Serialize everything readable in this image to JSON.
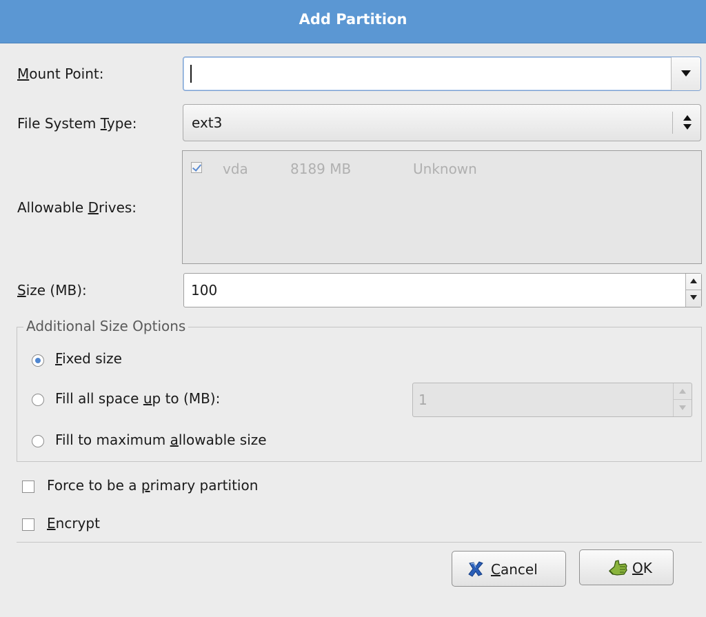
{
  "window": {
    "title": "Add Partition"
  },
  "form": {
    "mount_point": {
      "label_pre": "",
      "mnemonic": "M",
      "label_post": "ount Point:",
      "value": ""
    },
    "fs_type": {
      "label_pre": "File System ",
      "mnemonic": "T",
      "label_post": "ype:",
      "value": "ext3"
    },
    "drives": {
      "label_pre": "Allowable ",
      "mnemonic": "D",
      "label_post": "rives:",
      "rows": [
        {
          "name": "vda",
          "size": "8189 MB",
          "model": "Unknown",
          "checked": true
        }
      ]
    },
    "size": {
      "label_pre": "",
      "mnemonic": "S",
      "label_post": "ize (MB):",
      "value": "100"
    }
  },
  "size_options": {
    "legend": "Additional Size Options",
    "fixed": {
      "pre": "",
      "mnemonic": "F",
      "post": "ixed size",
      "selected": true
    },
    "fill_upto": {
      "pre": "Fill all space ",
      "mnemonic": "u",
      "post": "p to (MB):",
      "selected": false,
      "value": "1"
    },
    "fill_max": {
      "pre": "Fill to maximum ",
      "mnemonic": "a",
      "post": "llowable size",
      "selected": false
    }
  },
  "checks": {
    "primary": {
      "pre": "Force to be a ",
      "mnemonic": "p",
      "post": "rimary partition",
      "checked": false
    },
    "encrypt": {
      "pre": "",
      "mnemonic": "E",
      "post": "ncrypt",
      "checked": false
    }
  },
  "buttons": {
    "cancel": {
      "pre": "",
      "mnemonic": "C",
      "post": "ancel",
      "icon": "cancel-x-icon",
      "icon_color": "#2b5fb8"
    },
    "ok": {
      "pre": "",
      "mnemonic": "O",
      "post": "K",
      "icon": "ok-hand-icon",
      "icon_color": "#6e9a2e"
    }
  },
  "colors": {
    "titlebar": "#5b97d3",
    "background": "#ececec",
    "accent": "#4f86d0"
  }
}
